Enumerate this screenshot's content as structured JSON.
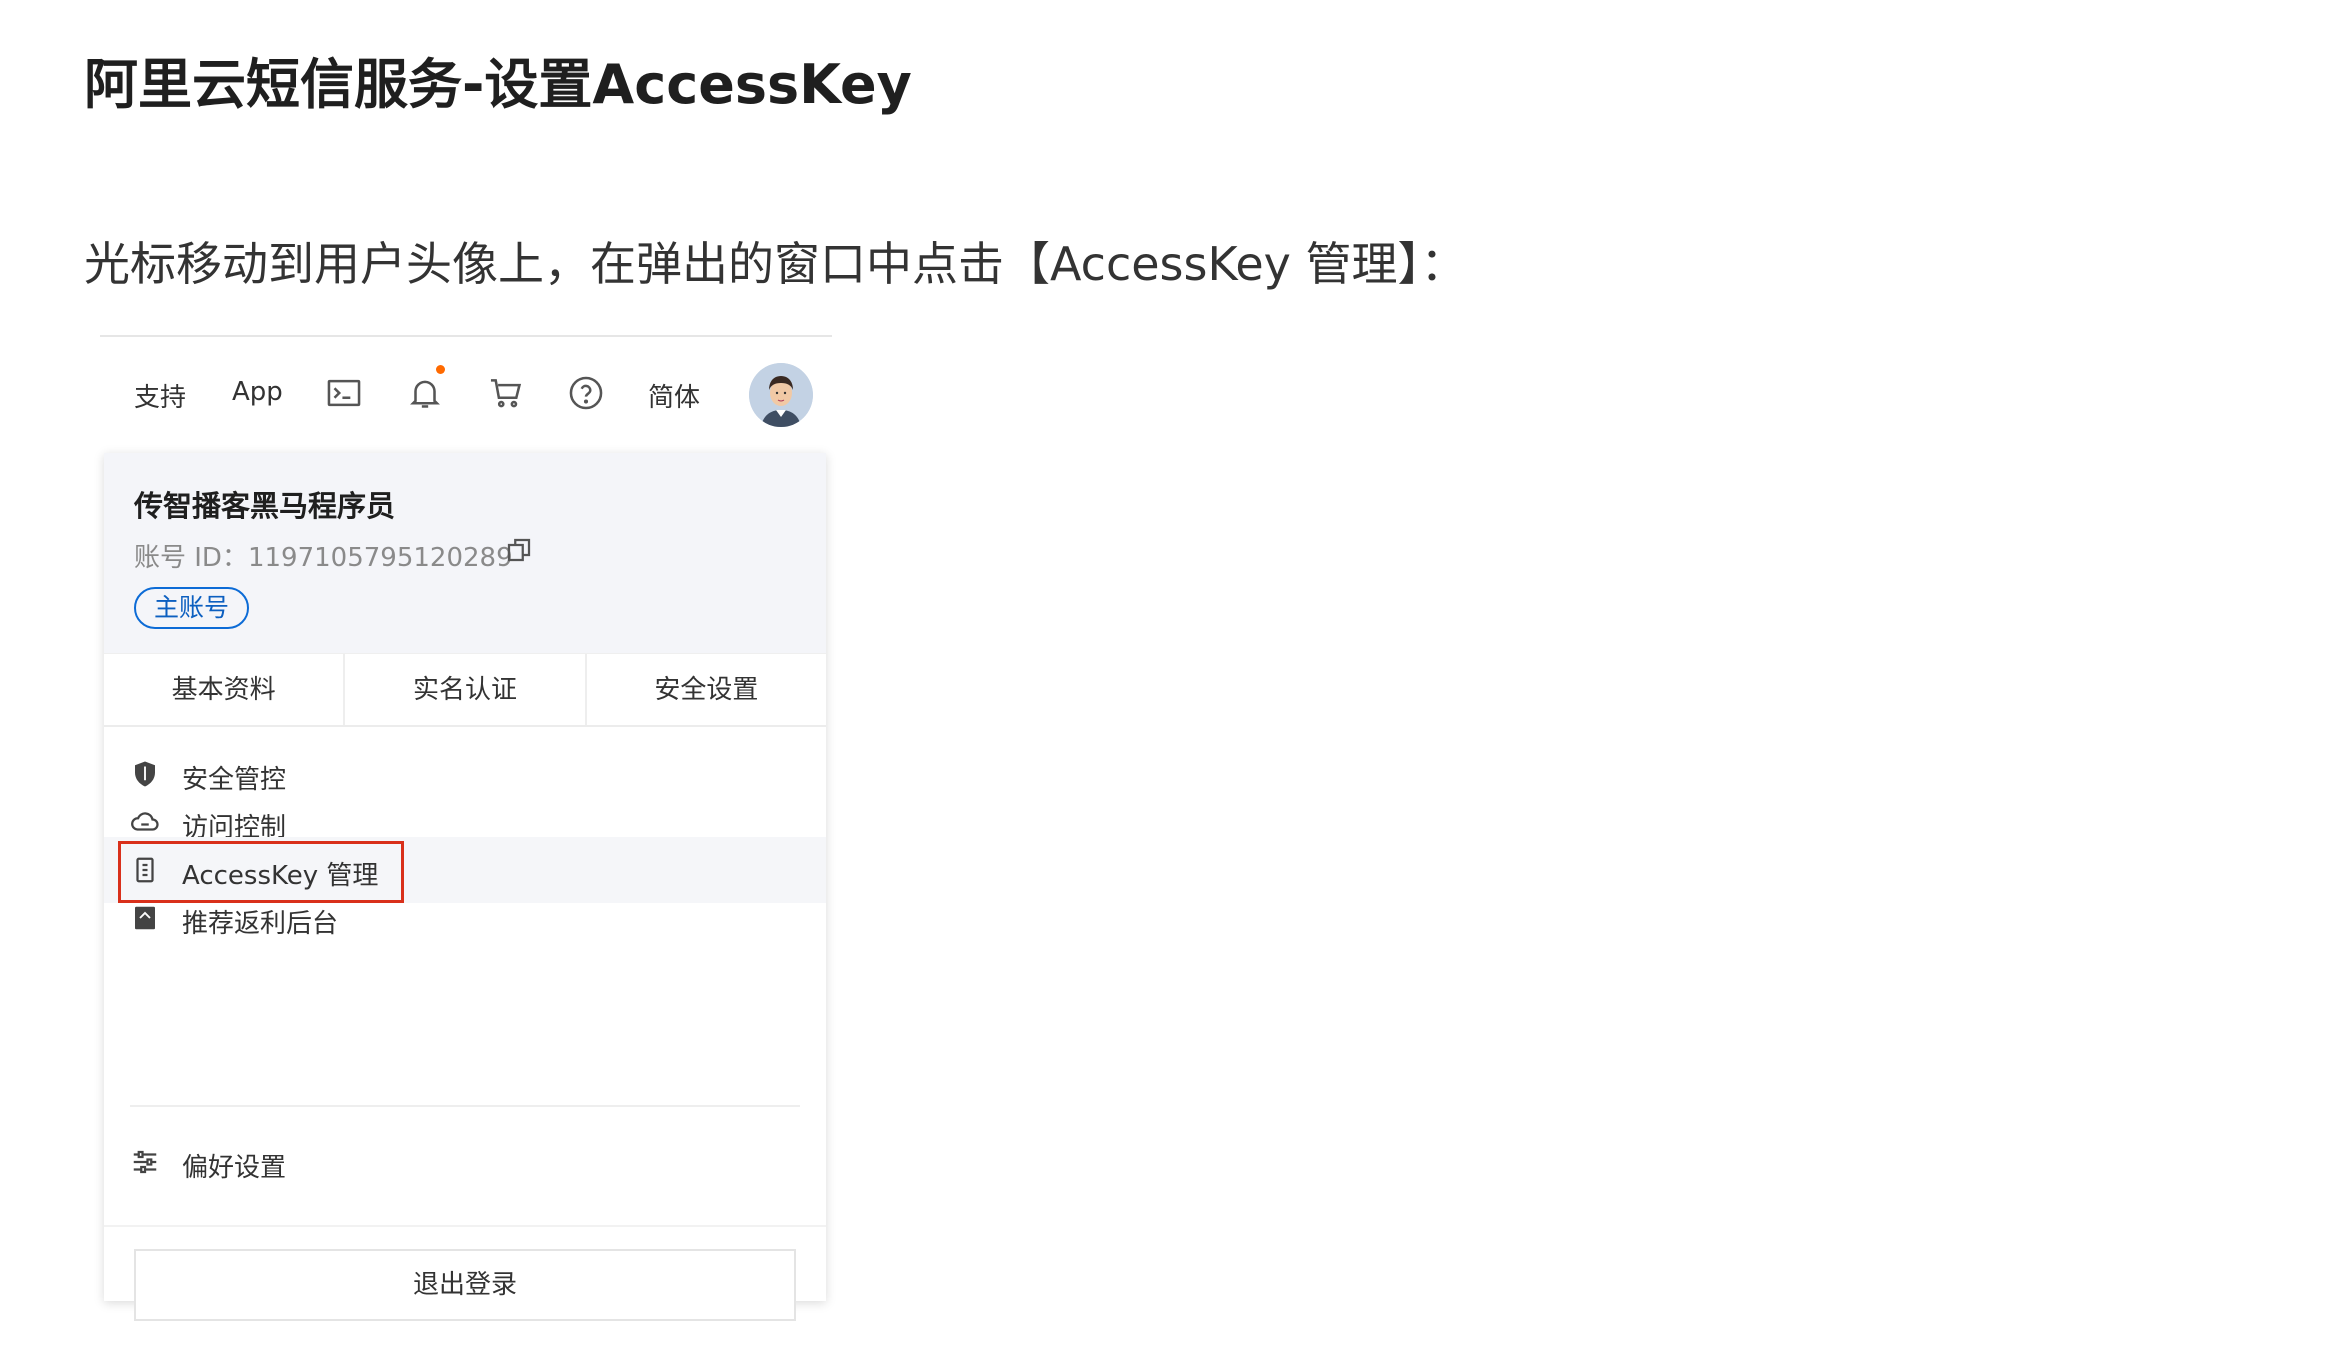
{
  "doc": {
    "title": "阿里云短信服务-设置AccessKey",
    "instruction": "光标移动到用户头像上，在弹出的窗口中点击【AccessKey 管理】："
  },
  "topbar": {
    "support_label": "支持",
    "app_label": "App",
    "terminal_icon": "terminal-icon",
    "bell_icon": "bell-icon",
    "cart_icon": "cart-icon",
    "help_icon": "help-circle-icon",
    "language_label": "简体",
    "avatar_icon": "user-avatar"
  },
  "account": {
    "name": "传智播客黑马程序员",
    "id_text": "账号 ID：1197105795120289",
    "badge": "主账号"
  },
  "tabs": [
    {
      "label": "基本资料"
    },
    {
      "label": "实名认证"
    },
    {
      "label": "安全设置"
    }
  ],
  "menu": [
    {
      "label": "安全管控",
      "icon": "shield-icon"
    },
    {
      "label": "访问控制",
      "icon": "cloud-icon"
    },
    {
      "label": "AccessKey 管理",
      "icon": "key-icon"
    },
    {
      "label": "推荐返利后台",
      "icon": "book-icon"
    },
    {
      "label": "偏好设置",
      "icon": "sliders-icon"
    }
  ],
  "logout_label": "退出登录",
  "colors": {
    "highlight": "#d9301b",
    "badge": "#0c6bd6",
    "notify_dot": "#ff6a00"
  }
}
